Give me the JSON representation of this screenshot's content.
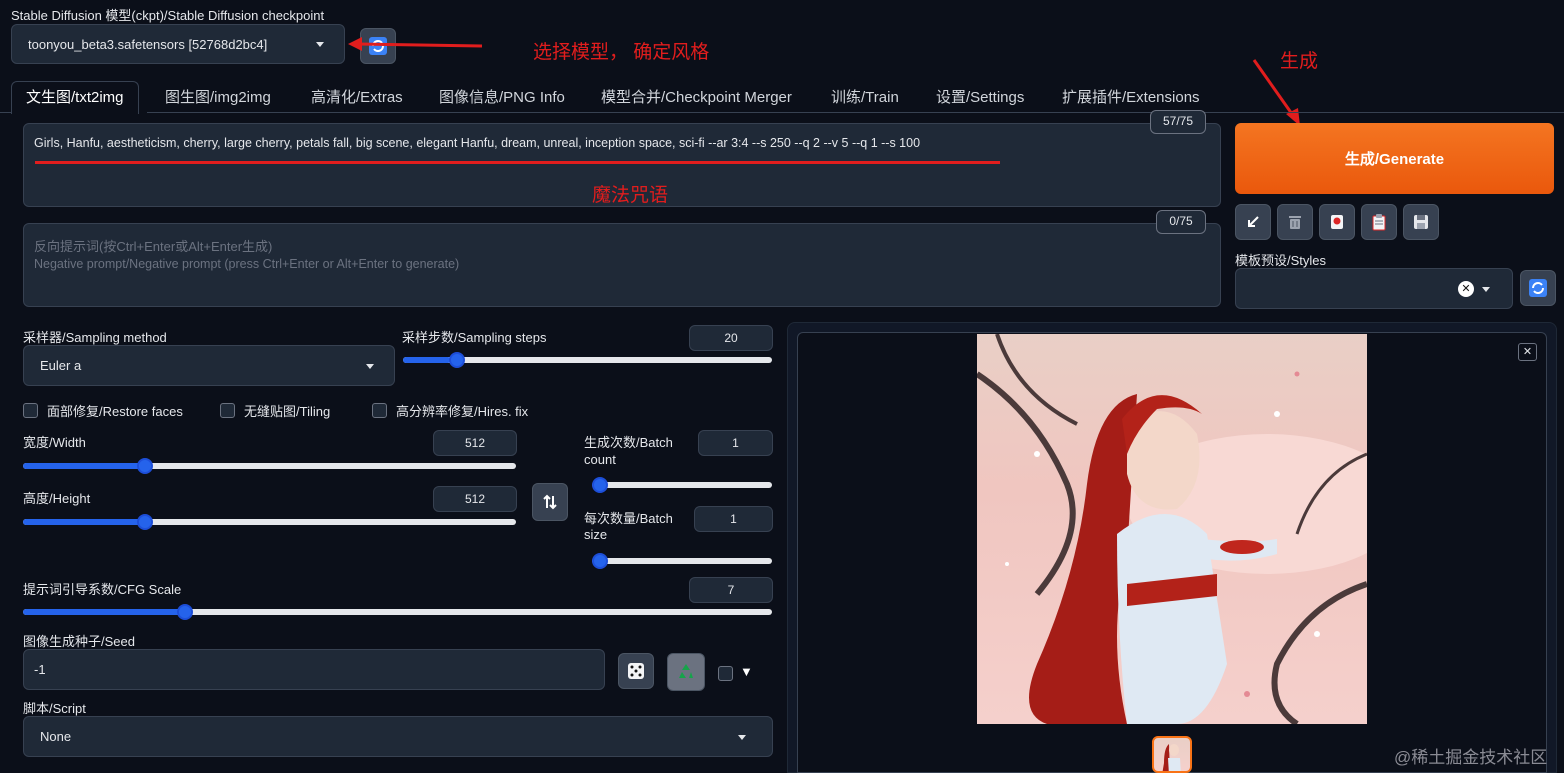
{
  "checkpoint": {
    "label": "Stable Diffusion 模型(ckpt)/Stable Diffusion checkpoint",
    "value": "toonyou_beta3.safetensors [52768d2bc4]"
  },
  "tabs": [
    {
      "label": "文生图/txt2img",
      "active": true
    },
    {
      "label": "图生图/img2img"
    },
    {
      "label": "高清化/Extras"
    },
    {
      "label": "图像信息/PNG Info"
    },
    {
      "label": "模型合并/Checkpoint Merger"
    },
    {
      "label": "训练/Train"
    },
    {
      "label": "设置/Settings"
    },
    {
      "label": "扩展插件/Extensions"
    }
  ],
  "prompt": {
    "text": "Girls, Hanfu, aestheticism, cherry, large cherry, petals fall, big scene, elegant Hanfu, dream, unreal, inception space, sci-fi --ar 3:4  --s 250    --q 2  --v 5 --q 1 --s 100",
    "counter": "57/75"
  },
  "negative_prompt": {
    "placeholder_line1": "反向提示词(按Ctrl+Enter或Alt+Enter生成)",
    "placeholder_line2": "Negative prompt/Negative prompt (press Ctrl+Enter or Alt+Enter to generate)",
    "counter": "0/75"
  },
  "generate": {
    "label": "生成/Generate",
    "color": "#f26b1d"
  },
  "styles": {
    "label": "模板预设/Styles",
    "value": ""
  },
  "sampler": {
    "label": "采样器/Sampling method",
    "value": "Euler a"
  },
  "steps": {
    "label": "采样步数/Sampling steps",
    "value": "20",
    "fraction": 0.13
  },
  "checkboxes": {
    "restore_faces": "面部修复/Restore faces",
    "tiling": "无缝贴图/Tiling",
    "hires": "高分辨率修复/Hires. fix"
  },
  "width": {
    "label": "宽度/Width",
    "value": "512",
    "fraction": 0.24
  },
  "height": {
    "label": "高度/Height",
    "value": "512",
    "fraction": 0.24
  },
  "batch_count": {
    "label_line1": "生成次数/Batch",
    "label_line2": "count",
    "value": "1",
    "fraction": 0.0
  },
  "batch_size": {
    "label_line1": "每次数量/Batch",
    "label_line2": "size",
    "value": "1",
    "fraction": 0.0
  },
  "cfg": {
    "label": "提示词引导系数/CFG Scale",
    "value": "7",
    "fraction": 0.21
  },
  "seed": {
    "label": "图像生成种子/Seed",
    "value": "-1"
  },
  "script": {
    "label": "脚本/Script",
    "value": "None"
  },
  "annotations": {
    "select_model": "选择模型， 确定风格",
    "generate": "生成",
    "magic": "魔法咒语"
  },
  "icons": {
    "refresh": "refresh-icon",
    "arrow": "arrow-down-left-icon",
    "trash": "trash-icon",
    "card": "model-card-icon",
    "clipboard": "clipboard-icon",
    "save": "save-icon",
    "dice": "dice-icon",
    "recycle": "recycle-icon",
    "swap": "swap-icon"
  },
  "watermark": "@稀土掘金技术社区",
  "colors": {
    "accent": "#2563eb",
    "annotation": "#e11d1d",
    "background": "#0b0f19"
  }
}
